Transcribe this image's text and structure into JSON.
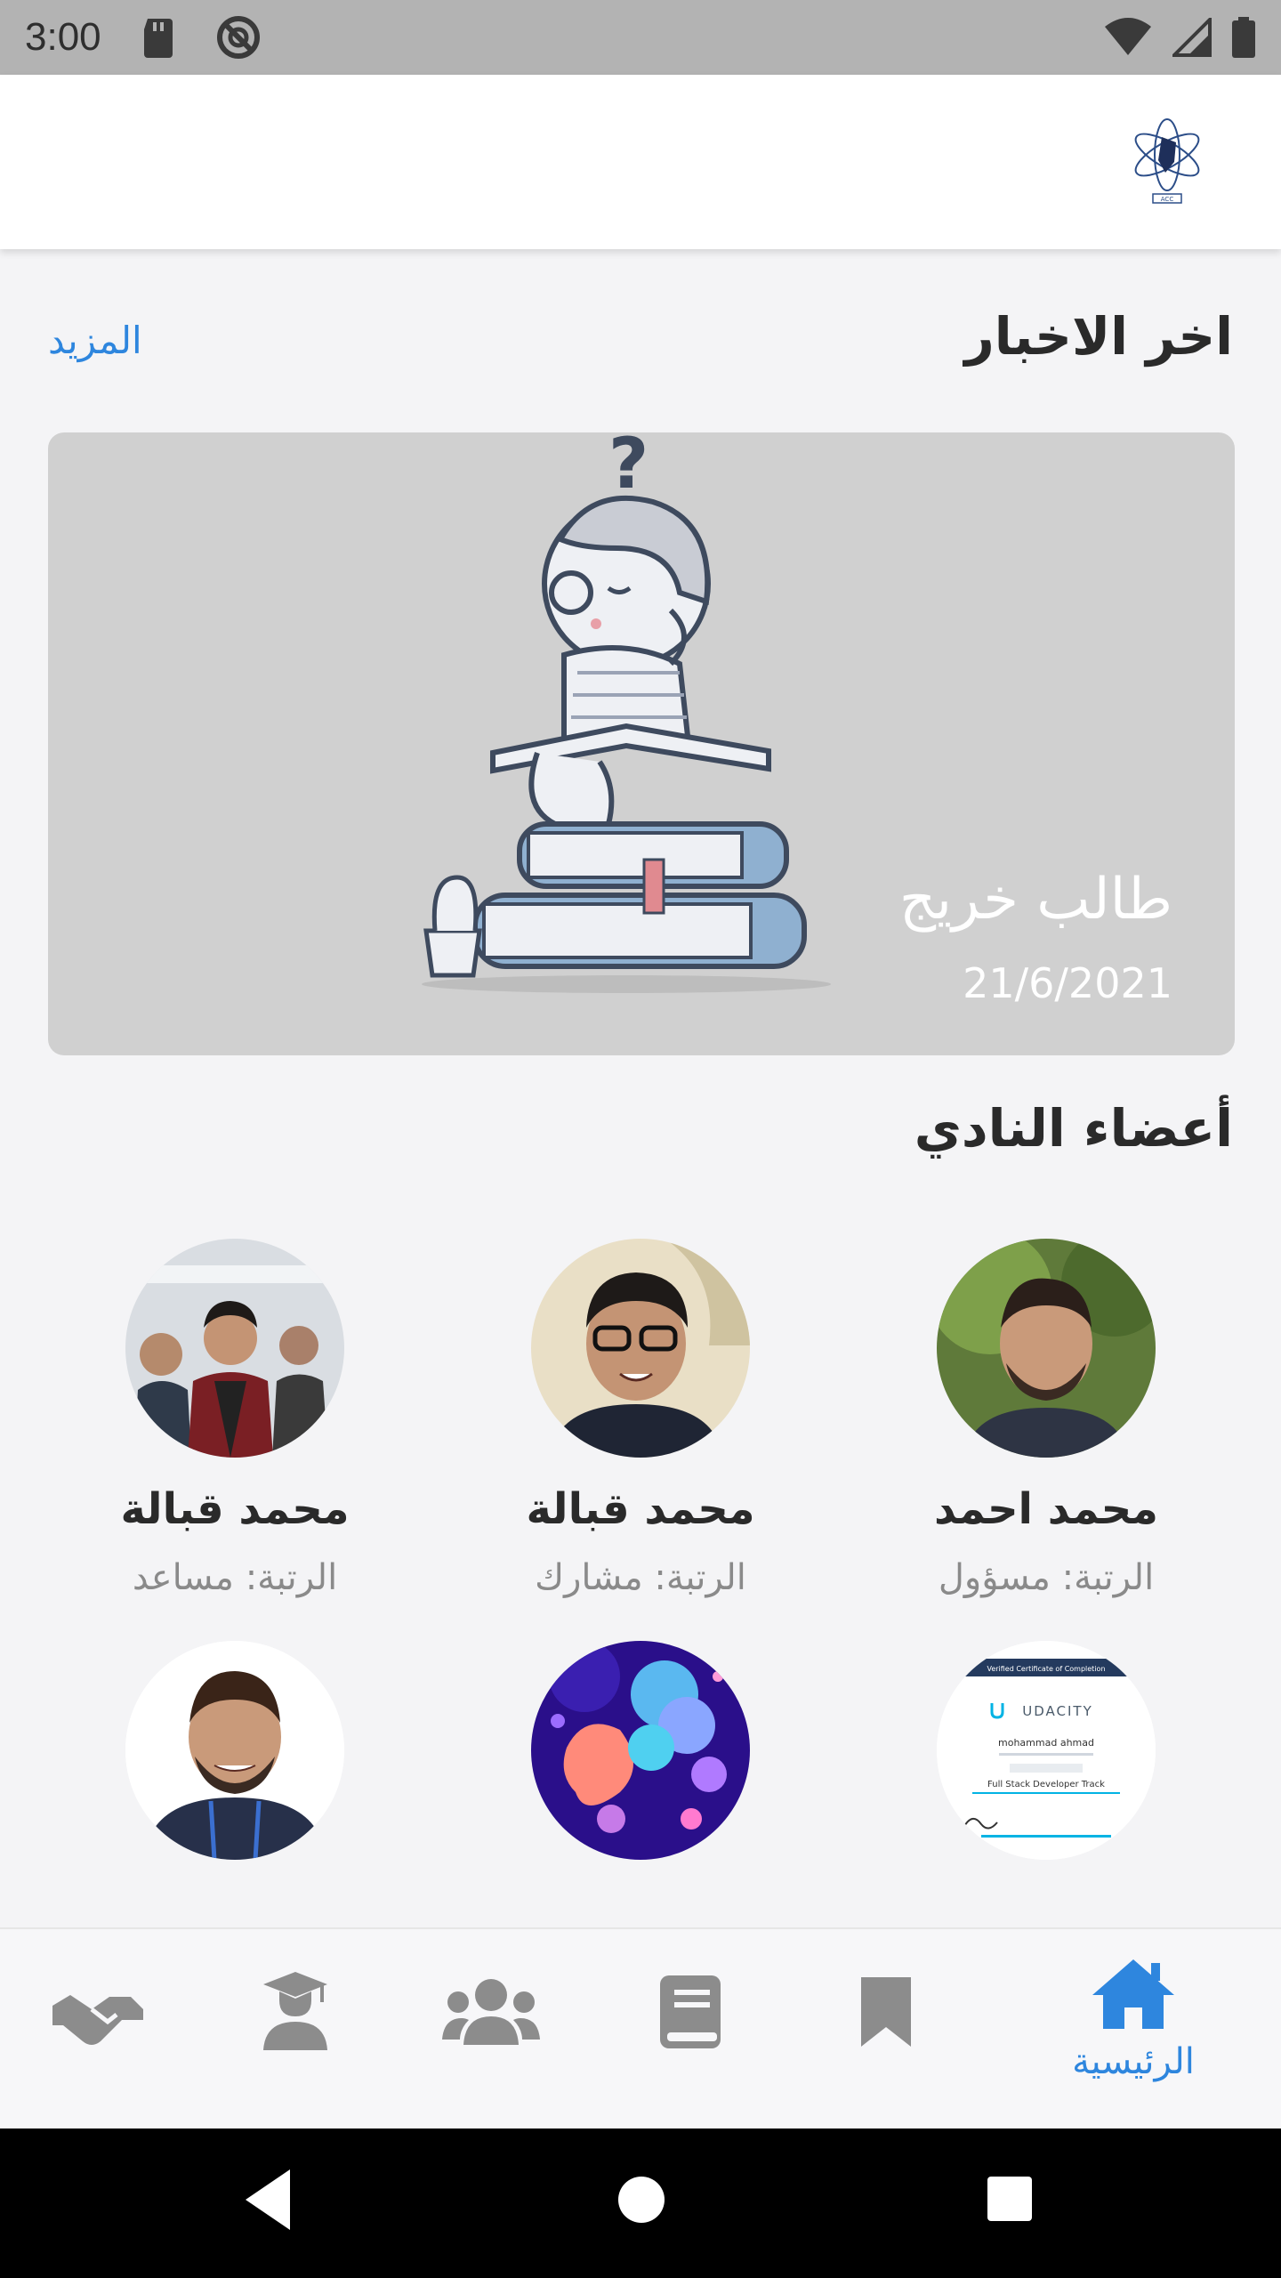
{
  "status_bar": {
    "time": "3:00",
    "icons": [
      "sd-card-icon",
      "no-disturb-icon",
      "wifi-icon",
      "signal-icon",
      "battery-icon"
    ]
  },
  "app_bar": {
    "logo": "acc-atom-logo",
    "logo_text": "ACC"
  },
  "news": {
    "section_title": "اخر الاخبار",
    "more_label": "المزيد",
    "card": {
      "headline": "طالب خريج",
      "date": "21/6/2021",
      "image": "student-thinking-illustration"
    }
  },
  "members": {
    "section_title": "أعضاء النادي",
    "items": [
      {
        "name": "محمد احمد",
        "rank": "الرتبة: مسؤول",
        "avatar": "photo-outdoor"
      },
      {
        "name": "محمد قبالة",
        "rank": "الرتبة: مشارك",
        "avatar": "photo-glasses"
      },
      {
        "name": "محمد قبالة",
        "rank": "الرتبة: مساعد",
        "avatar": "photo-group"
      },
      {
        "name": "",
        "rank": "",
        "avatar": "certificate-udacity"
      },
      {
        "name": "",
        "rank": "",
        "avatar": "abstract-bubbles"
      },
      {
        "name": "",
        "rank": "",
        "avatar": "photo-portrait"
      }
    ],
    "certificate": {
      "header": "Verified Certificate of Completion",
      "brand": "UDACITY",
      "name": "mohammad ahmad",
      "track": "Full Stack Developer Track"
    }
  },
  "bottom_nav": {
    "items": [
      {
        "label": "الرئيسية",
        "icon": "home-icon",
        "active": true
      },
      {
        "label": "",
        "icon": "bookmark-icon",
        "active": false
      },
      {
        "label": "",
        "icon": "book-icon",
        "active": false
      },
      {
        "label": "",
        "icon": "users-icon",
        "active": false
      },
      {
        "label": "",
        "icon": "graduate-icon",
        "active": false
      },
      {
        "label": "",
        "icon": "handshake-icon",
        "active": false
      }
    ]
  },
  "colors": {
    "accent": "#2e86de",
    "inactive_icon": "#8c8c8c",
    "status_bar": "#b3b3b3",
    "card_bg": "#d0d0d0"
  }
}
